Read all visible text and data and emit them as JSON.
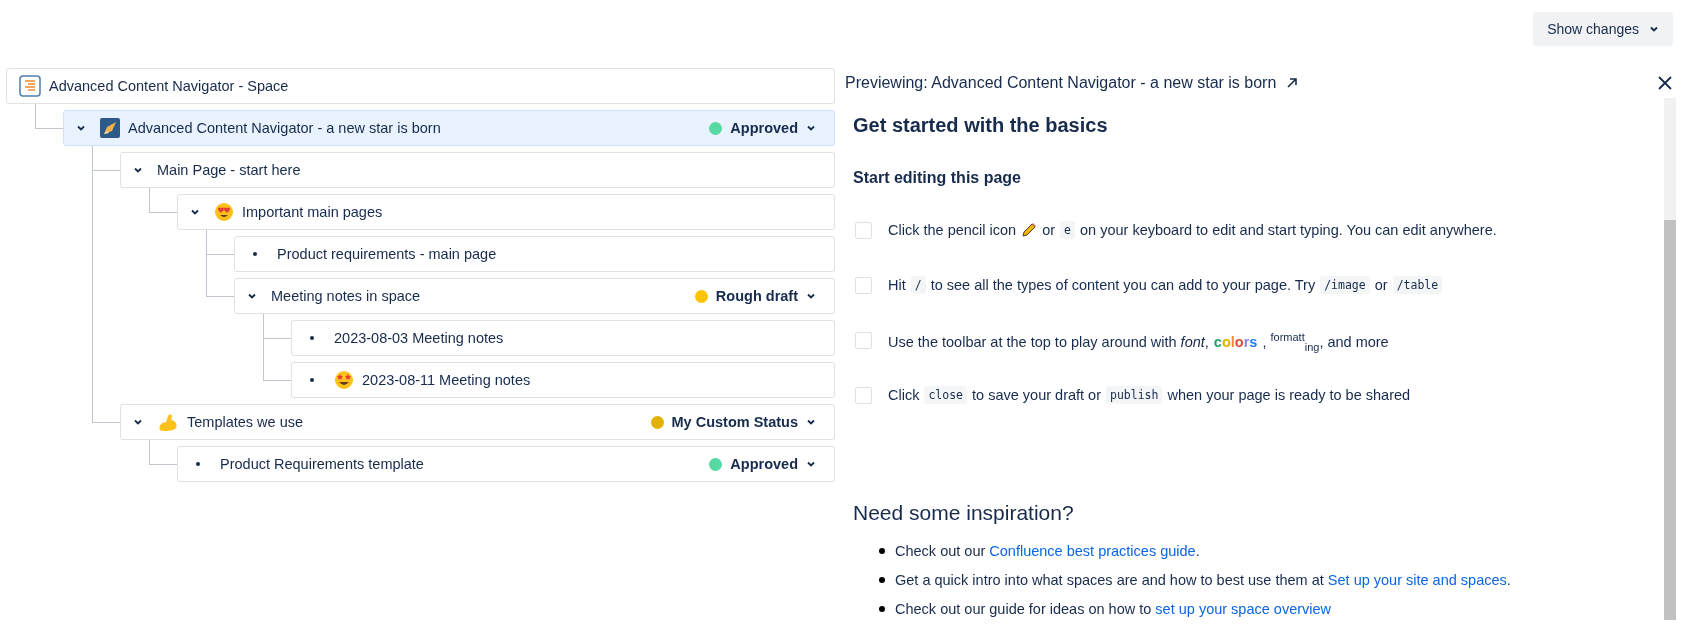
{
  "top_bar": {
    "show_changes_button": "Show changes"
  },
  "tree": {
    "title": "Advanced Content Navigator - Space",
    "kind": "space",
    "children": [
      {
        "title": "Advanced Content Navigator - a new star is born",
        "kind": "rocket",
        "expanded": true,
        "selected": true,
        "status": {
          "label": "Approved",
          "color": "#57d9a3"
        },
        "children": [
          {
            "title": "Main Page - start here",
            "expanded": true,
            "selected": false,
            "children": [
              {
                "title": "Important main pages",
                "kind": "heart-eyes",
                "expanded": true,
                "selected": false,
                "children": [
                  {
                    "title": "Product requirements - main page",
                    "selected": false
                  },
                  {
                    "title": "Meeting notes in space",
                    "expanded": true,
                    "selected": false,
                    "status": {
                      "label": "Rough draft",
                      "color": "#ffc400"
                    },
                    "children": [
                      {
                        "title": "2023-08-03 Meeting notes",
                        "selected": false
                      },
                      {
                        "title": "2023-08-11 Meeting notes",
                        "kind": "star-struck",
                        "selected": false
                      }
                    ]
                  }
                ]
              }
            ]
          },
          {
            "title": "Templates we use",
            "kind": "muscle",
            "expanded": true,
            "selected": false,
            "status": {
              "label": "My Custom Status",
              "color": "#e2b203"
            },
            "children": [
              {
                "title": "Product Requirements template",
                "selected": false,
                "status": {
                  "label": "Approved",
                  "color": "#57d9a3"
                }
              }
            ]
          }
        ]
      }
    ]
  },
  "preview": {
    "title": "Previewing: Advanced Content Navigator - a new star is born",
    "heading": "Get started with the basics",
    "subheading": "Start editing this page",
    "tasks": [
      {
        "checked": false,
        "parts": [
          {
            "kind": "text",
            "text": "Click the pencil icon"
          },
          {
            "kind": "pencil"
          },
          {
            "kind": "text",
            "text": "or"
          },
          {
            "kind": "code",
            "text": "e"
          },
          {
            "kind": "text",
            "text": "on your keyboard to edit and start typing. You can edit anywhere."
          }
        ]
      },
      {
        "checked": false,
        "parts": [
          {
            "kind": "text",
            "text": "Hit"
          },
          {
            "kind": "code",
            "text": "/"
          },
          {
            "kind": "text",
            "text": "to see all the types of content you can add to your page. Try"
          },
          {
            "kind": "code",
            "text": "/image"
          },
          {
            "kind": "text",
            "text": "or"
          },
          {
            "kind": "code",
            "text": "/table"
          }
        ]
      },
      {
        "checked": false,
        "parts": [
          {
            "kind": "text",
            "text": "Use the toolbar at the top to play around with *font*,"
          },
          {
            "kind": "rainbow",
            "text": "colors"
          },
          {
            "kind": "text",
            "text": ", $^{formatt}$$_{ing}$, and more"
          }
        ]
      },
      {
        "checked": false,
        "parts": [
          {
            "kind": "text",
            "text": "Click"
          },
          {
            "kind": "code",
            "text": "close"
          },
          {
            "kind": "text",
            "text": "to save your draft or"
          },
          {
            "kind": "code",
            "text": "publish"
          },
          {
            "kind": "text",
            "text": "when your page is ready to be shared"
          }
        ]
      }
    ],
    "inspiration_heading": "Need some inspiration?",
    "bullets": [
      {
        "text": "Check out our",
        "link": "Confluence best practices guide",
        "after": "."
      },
      {
        "text": "Get a quick intro into what spaces are and how to best use them at",
        "link": "Set up your site and spaces",
        "after": "."
      },
      {
        "text": "Check out our guide for ideas on how to",
        "link": "set up your space overview"
      }
    ]
  }
}
